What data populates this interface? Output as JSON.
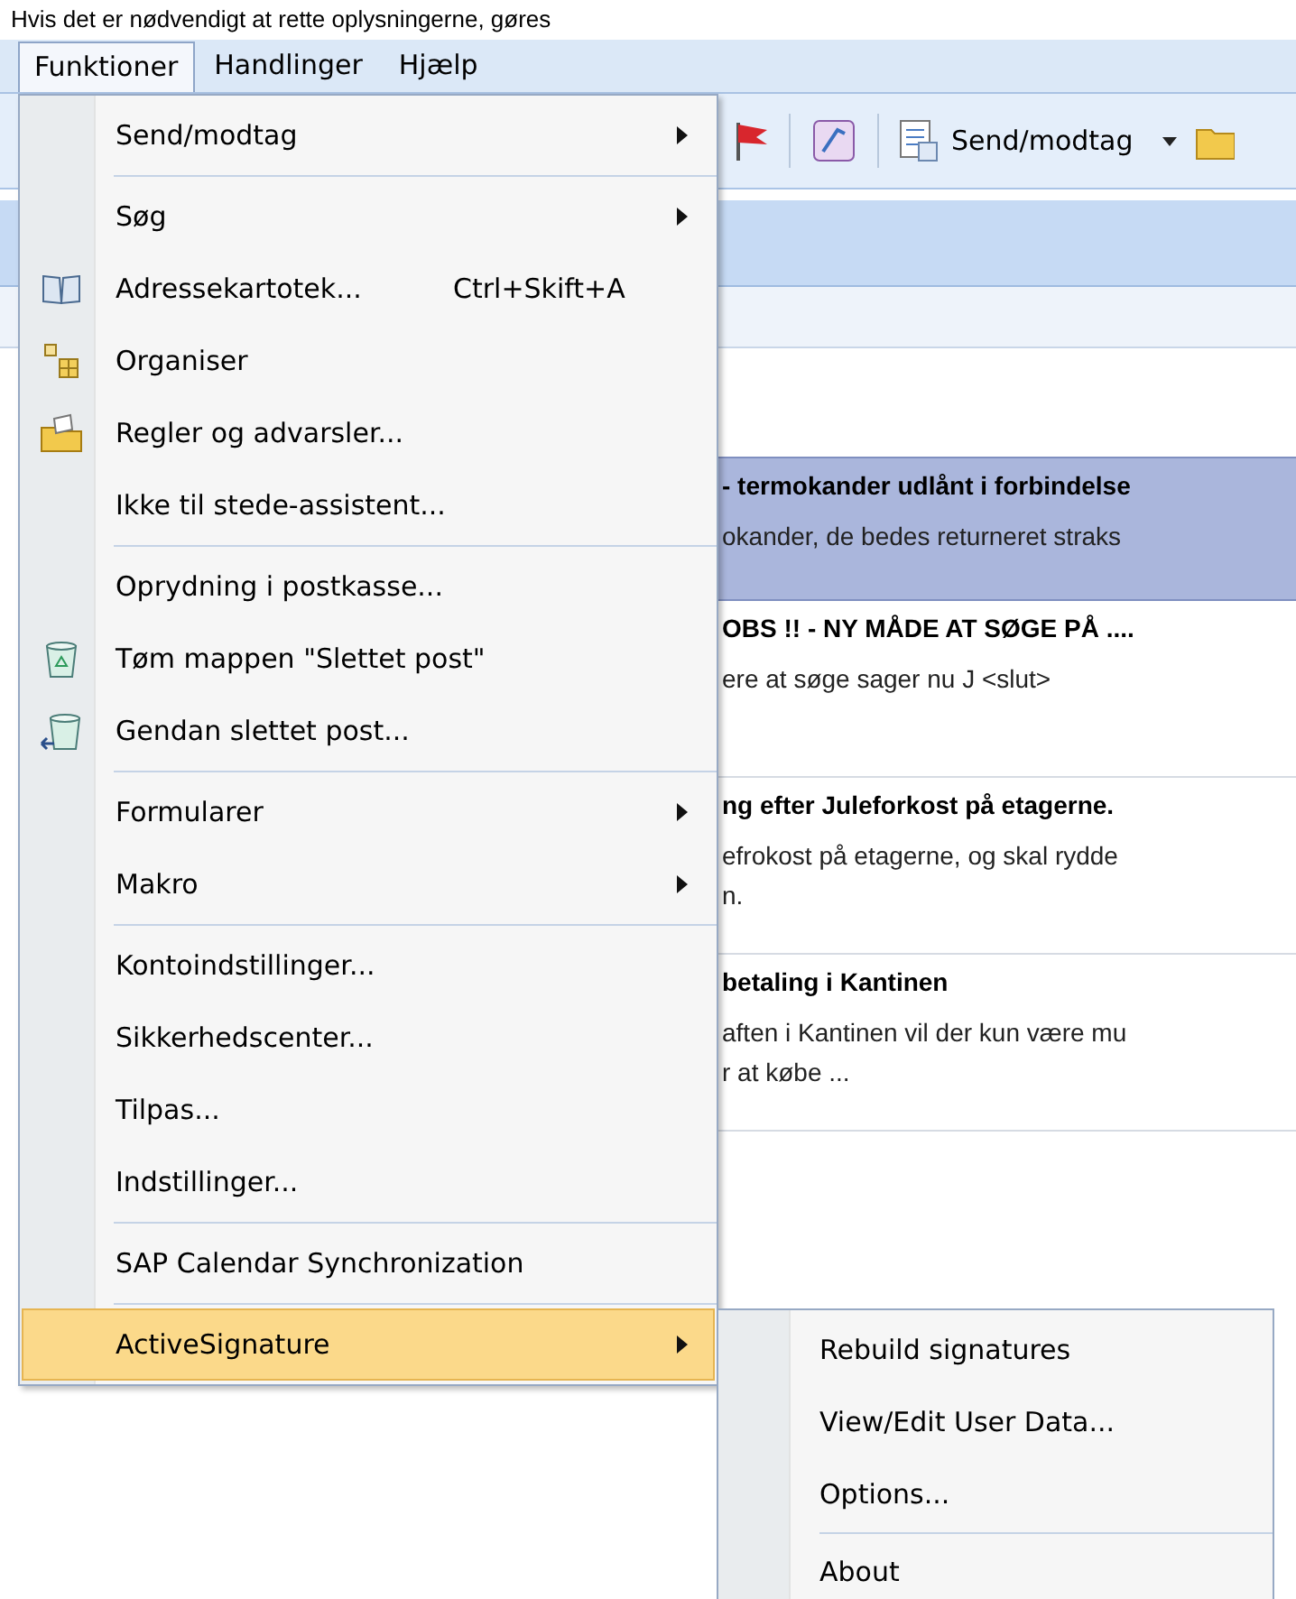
{
  "caption": "Hvis det er nødvendigt at rette oplysningerne, gøres",
  "menubar": [
    {
      "label": "Funktioner",
      "selected": true
    },
    {
      "label": "Handlinger",
      "selected": false
    },
    {
      "label": "Hjælp",
      "selected": false
    }
  ],
  "toolbar": {
    "send_receive": "Send/modtag"
  },
  "messages": [
    {
      "subject": "- termokander udlånt i forbindelse",
      "preview": [
        "okander, de bedes returneret straks"
      ],
      "selected": true
    },
    {
      "subject": "OBS !! - NY MÅDE AT SØGE PÅ ....",
      "preview": [
        "ere at søge sager nu J <slut>"
      ],
      "selected": false
    },
    {
      "subject": "ng efter Juleforkost på etagerne.",
      "preview": [
        "efrokost på etagerne, og skal rydde",
        "n."
      ],
      "selected": false
    },
    {
      "subject": "betaling i Kantinen",
      "preview": [
        "aften i Kantinen vil der kun være mu",
        "r at købe ..."
      ],
      "selected": false
    }
  ],
  "menu": [
    [
      {
        "label": "Send/modtag",
        "submenu": true,
        "selected": false
      }
    ],
    [
      {
        "label": "Søg",
        "submenu": true,
        "selected": false
      },
      {
        "label": "Adressekartotek...",
        "shortcut": "Ctrl+Skift+A",
        "kind": "book",
        "submenu": false,
        "selected": false
      },
      {
        "label": "Organiser",
        "kind": "organize",
        "submenu": false,
        "selected": false
      },
      {
        "label": "Regler og advarsler...",
        "kind": "rules",
        "submenu": false,
        "selected": false
      },
      {
        "label": "Ikke til stede-assistent...",
        "submenu": false,
        "selected": false
      }
    ],
    [
      {
        "label": "Oprydning i postkasse...",
        "submenu": false,
        "selected": false
      },
      {
        "label": "Tøm mappen \"Slettet post\"",
        "kind": "bin",
        "submenu": false,
        "selected": false
      },
      {
        "label": "Gendan slettet post...",
        "kind": "restore",
        "submenu": false,
        "selected": false
      }
    ],
    [
      {
        "label": "Formularer",
        "submenu": true,
        "selected": false
      },
      {
        "label": "Makro",
        "submenu": true,
        "selected": false
      }
    ],
    [
      {
        "label": "Kontoindstillinger...",
        "submenu": false,
        "selected": false
      },
      {
        "label": "Sikkerhedscenter...",
        "submenu": false,
        "selected": false
      },
      {
        "label": "Tilpas...",
        "submenu": false,
        "selected": false
      },
      {
        "label": "Indstillinger...",
        "submenu": false,
        "selected": false
      }
    ],
    [
      {
        "label": "SAP Calendar Synchronization",
        "submenu": false,
        "selected": false
      }
    ],
    [
      {
        "label": "ActiveSignature",
        "submenu": true,
        "selected": true
      }
    ]
  ],
  "submenu": [
    [
      {
        "label": "Rebuild signatures"
      },
      {
        "label": "View/Edit User Data..."
      },
      {
        "label": "Options..."
      }
    ],
    [
      {
        "label": "About"
      }
    ]
  ]
}
